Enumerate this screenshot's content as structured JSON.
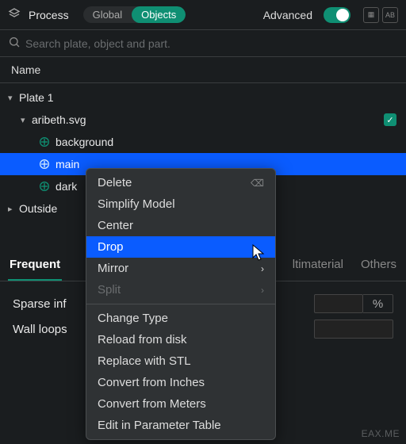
{
  "top": {
    "title": "Process",
    "seg": [
      "Global",
      "Objects"
    ],
    "advanced": "Advanced"
  },
  "search": {
    "placeholder": "Search plate, object and part."
  },
  "header": "Name",
  "tree": {
    "plate": "Plate 1",
    "file": "aribeth.svg",
    "items": [
      "background",
      "main",
      "dark"
    ],
    "outside": "Outside"
  },
  "context_menu": {
    "items": [
      {
        "label": "Delete",
        "delete_icon": true
      },
      {
        "label": "Simplify Model"
      },
      {
        "label": "Center"
      },
      {
        "label": "Drop",
        "selected": true
      },
      {
        "label": "Mirror",
        "submenu": true
      },
      {
        "label": "Split",
        "submenu": true,
        "disabled": true
      },
      {
        "separator": true
      },
      {
        "label": "Change Type"
      },
      {
        "label": "Reload from disk"
      },
      {
        "label": "Replace with STL"
      },
      {
        "label": "Convert from Inches"
      },
      {
        "label": "Convert from Meters"
      },
      {
        "label": "Edit in Parameter Table"
      }
    ]
  },
  "tabs": [
    "Frequent",
    "ltimaterial",
    "Others"
  ],
  "settings": {
    "row1": {
      "label": "Sparse inf",
      "unit": "%"
    },
    "row2": {
      "label": "Wall loops"
    }
  },
  "watermark": "EAX.ME"
}
